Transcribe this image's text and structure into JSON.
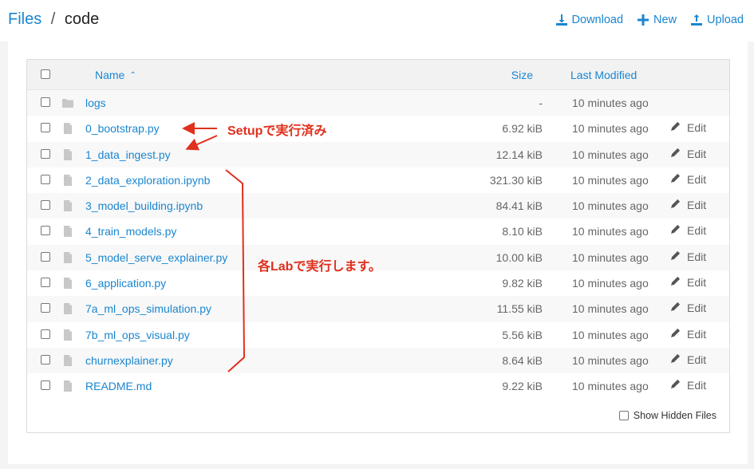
{
  "breadcrumb": {
    "root": "Files",
    "separator": "/",
    "current": "code"
  },
  "actions": {
    "download": "Download",
    "new": "New",
    "upload": "Upload"
  },
  "table": {
    "columns": {
      "name": "Name",
      "size": "Size",
      "modified": "Last Modified"
    },
    "edit_label": "Edit",
    "rows": [
      {
        "type": "folder",
        "name": "logs",
        "size": "-",
        "modified": "10 minutes ago",
        "editable": false
      },
      {
        "type": "file",
        "name": "0_bootstrap.py",
        "size": "6.92 kiB",
        "modified": "10 minutes ago",
        "editable": true
      },
      {
        "type": "file",
        "name": "1_data_ingest.py",
        "size": "12.14 kiB",
        "modified": "10 minutes ago",
        "editable": true
      },
      {
        "type": "file",
        "name": "2_data_exploration.ipynb",
        "size": "321.30 kiB",
        "modified": "10 minutes ago",
        "editable": true
      },
      {
        "type": "file",
        "name": "3_model_building.ipynb",
        "size": "84.41 kiB",
        "modified": "10 minutes ago",
        "editable": true
      },
      {
        "type": "file",
        "name": "4_train_models.py",
        "size": "8.10 kiB",
        "modified": "10 minutes ago",
        "editable": true
      },
      {
        "type": "file",
        "name": "5_model_serve_explainer.py",
        "size": "10.00 kiB",
        "modified": "10 minutes ago",
        "editable": true
      },
      {
        "type": "file",
        "name": "6_application.py",
        "size": "9.82 kiB",
        "modified": "10 minutes ago",
        "editable": true
      },
      {
        "type": "file",
        "name": "7a_ml_ops_simulation.py",
        "size": "11.55 kiB",
        "modified": "10 minutes ago",
        "editable": true
      },
      {
        "type": "file",
        "name": "7b_ml_ops_visual.py",
        "size": "5.56 kiB",
        "modified": "10 minutes ago",
        "editable": true
      },
      {
        "type": "file",
        "name": "churnexplainer.py",
        "size": "8.64 kiB",
        "modified": "10 minutes ago",
        "editable": true
      },
      {
        "type": "file",
        "name": "README.md",
        "size": "9.22 kiB",
        "modified": "10 minutes ago",
        "editable": true
      }
    ],
    "show_hidden_label": "Show Hidden Files"
  },
  "annotations": {
    "setup": "Setupで実行済み",
    "labs": "各Labで実行します。"
  },
  "colors": {
    "link": "#1a86d0",
    "annotation": "#e0301e"
  },
  "icons": [
    "download-icon",
    "plus-icon",
    "upload-icon",
    "folder-icon",
    "file-icon",
    "pencil-icon",
    "sort-asc-icon"
  ]
}
